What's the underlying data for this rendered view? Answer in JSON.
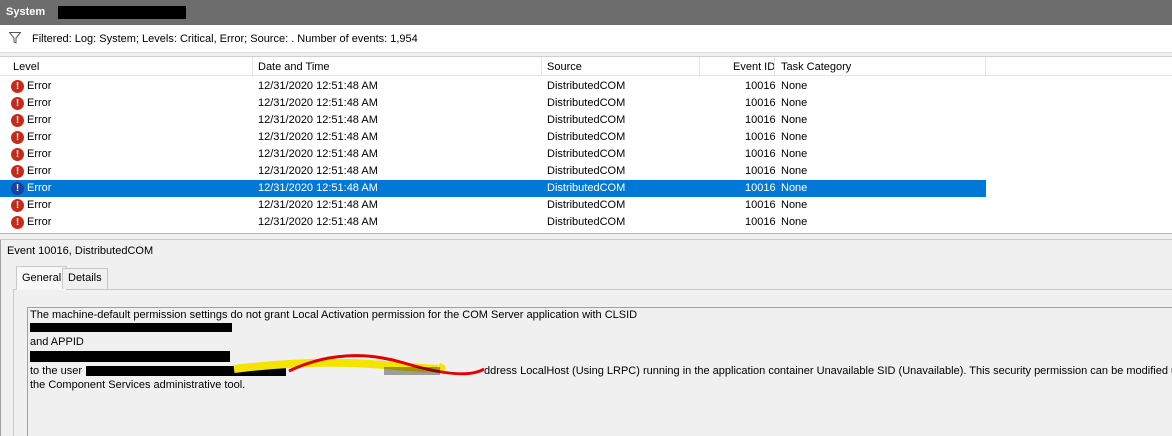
{
  "window": {
    "title": "System"
  },
  "filter": {
    "icon": "funnel-icon",
    "text": "Filtered: Log: System; Levels: Critical, Error; Source: . Number of events: 1,954"
  },
  "columns": {
    "level": "Level",
    "date": "Date and Time",
    "source": "Source",
    "event_id": "Event ID",
    "task": "Task Category"
  },
  "rows": [
    {
      "level": "Error",
      "date": "12/31/2020 12:51:48 AM",
      "source": "DistributedCOM",
      "event_id": "10016",
      "task": "None"
    },
    {
      "level": "Error",
      "date": "12/31/2020 12:51:48 AM",
      "source": "DistributedCOM",
      "event_id": "10016",
      "task": "None"
    },
    {
      "level": "Error",
      "date": "12/31/2020 12:51:48 AM",
      "source": "DistributedCOM",
      "event_id": "10016",
      "task": "None"
    },
    {
      "level": "Error",
      "date": "12/31/2020 12:51:48 AM",
      "source": "DistributedCOM",
      "event_id": "10016",
      "task": "None"
    },
    {
      "level": "Error",
      "date": "12/31/2020 12:51:48 AM",
      "source": "DistributedCOM",
      "event_id": "10016",
      "task": "None"
    },
    {
      "level": "Error",
      "date": "12/31/2020 12:51:48 AM",
      "source": "DistributedCOM",
      "event_id": "10016",
      "task": "None"
    },
    {
      "level": "Error",
      "date": "12/31/2020 12:51:48 AM",
      "source": "DistributedCOM",
      "event_id": "10016",
      "task": "None",
      "selected": true
    },
    {
      "level": "Error",
      "date": "12/31/2020 12:51:48 AM",
      "source": "DistributedCOM",
      "event_id": "10016",
      "task": "None"
    },
    {
      "level": "Error",
      "date": "12/31/2020 12:51:48 AM",
      "source": "DistributedCOM",
      "event_id": "10016",
      "task": "None"
    }
  ],
  "detail": {
    "title": "Event 10016, DistributedCOM",
    "tabs": [
      "General",
      "Details"
    ],
    "message": {
      "line1": "The machine-default permission settings do not grant Local Activation permission for the COM Server application with CLSID",
      "line3": " and APPID",
      "line5_suffix": "ddress LocalHost (Using LRPC) running in the application container Unavailable SID (Unavailable). This security permission can be modified using",
      "line5_prefix": " to the user",
      "line6": "the Component Services administrative tool."
    }
  },
  "colors": {
    "selection": "#0078d7",
    "error_icon": "#c42b1c",
    "titlebar": "#6d6d6d"
  }
}
